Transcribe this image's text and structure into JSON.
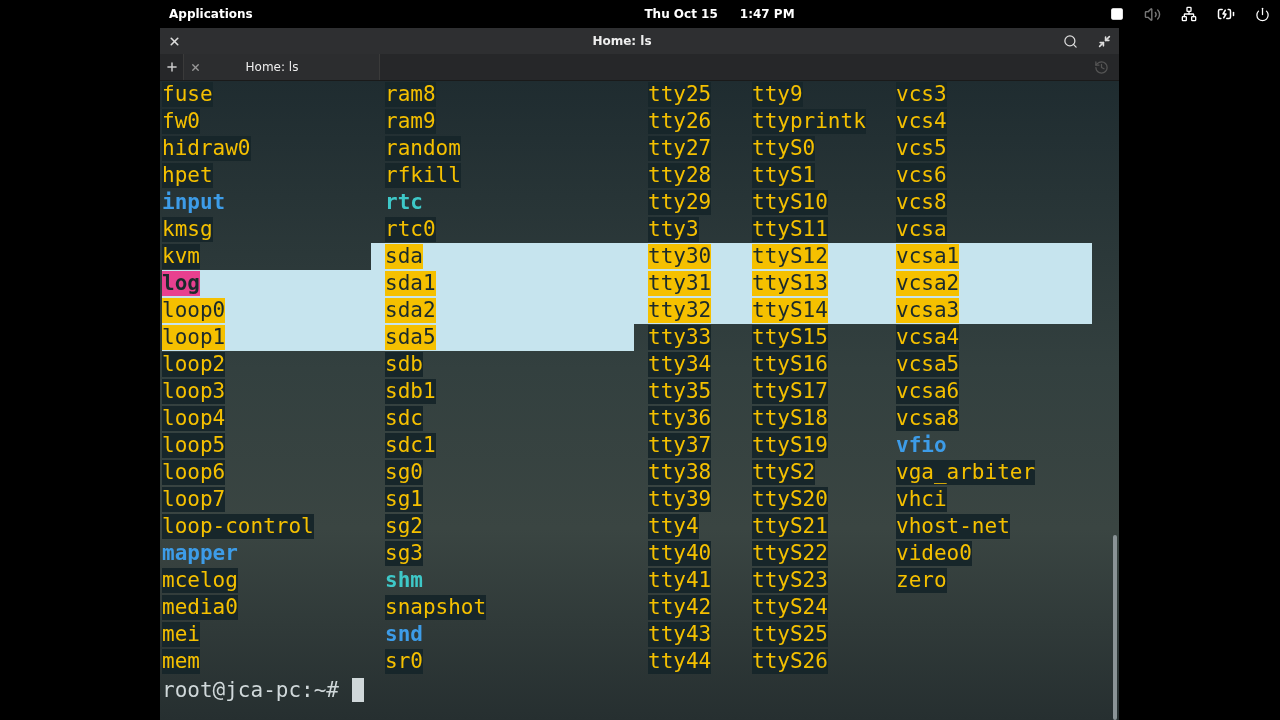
{
  "top_panel": {
    "menu": "Applications",
    "date": "Thu Oct 15",
    "time": "1:47 PM"
  },
  "window": {
    "title": "Home: ls"
  },
  "tabs": [
    {
      "label": "Home: ls",
      "selected": true
    }
  ],
  "terminal": {
    "rows": [
      {
        "cells": [
          {
            "text": "fuse",
            "kind": "device",
            "selected": false
          },
          {
            "text": "ram8",
            "kind": "device",
            "selected": false
          },
          {
            "text": "tty25",
            "kind": "device",
            "selected": false
          },
          {
            "text": "tty9",
            "kind": "device",
            "selected": false
          },
          {
            "text": "vcs3",
            "kind": "device",
            "selected": false
          }
        ]
      },
      {
        "cells": [
          {
            "text": "fw0",
            "kind": "device",
            "selected": false
          },
          {
            "text": "ram9",
            "kind": "device",
            "selected": false
          },
          {
            "text": "tty26",
            "kind": "device",
            "selected": false
          },
          {
            "text": "ttyprintk",
            "kind": "device",
            "selected": false
          },
          {
            "text": "vcs4",
            "kind": "device",
            "selected": false
          }
        ]
      },
      {
        "cells": [
          {
            "text": "hidraw0",
            "kind": "device",
            "selected": false
          },
          {
            "text": "random",
            "kind": "device",
            "selected": false
          },
          {
            "text": "tty27",
            "kind": "device",
            "selected": false
          },
          {
            "text": "ttyS0",
            "kind": "device",
            "selected": false
          },
          {
            "text": "vcs5",
            "kind": "device",
            "selected": false
          }
        ]
      },
      {
        "cells": [
          {
            "text": "hpet",
            "kind": "device",
            "selected": false
          },
          {
            "text": "rfkill",
            "kind": "device",
            "selected": false
          },
          {
            "text": "tty28",
            "kind": "device",
            "selected": false
          },
          {
            "text": "ttyS1",
            "kind": "device",
            "selected": false
          },
          {
            "text": "vcs6",
            "kind": "device",
            "selected": false
          }
        ]
      },
      {
        "cells": [
          {
            "text": "input",
            "kind": "dir",
            "selected": false
          },
          {
            "text": "rtc",
            "kind": "link",
            "selected": false
          },
          {
            "text": "tty29",
            "kind": "device",
            "selected": false
          },
          {
            "text": "ttyS10",
            "kind": "device",
            "selected": false
          },
          {
            "text": "vcs8",
            "kind": "device",
            "selected": false
          }
        ]
      },
      {
        "cells": [
          {
            "text": "kmsg",
            "kind": "device",
            "selected": false
          },
          {
            "text": "rtc0",
            "kind": "device",
            "selected": false
          },
          {
            "text": "tty3",
            "kind": "device",
            "selected": false
          },
          {
            "text": "ttyS11",
            "kind": "device",
            "selected": false
          },
          {
            "text": "vcsa",
            "kind": "device",
            "selected": false
          }
        ]
      },
      {
        "cells": [
          {
            "text": "kvm",
            "kind": "device",
            "selected": false
          },
          {
            "text": "sda",
            "kind": "device",
            "selected": true
          },
          {
            "text": "tty30",
            "kind": "device",
            "selected": true
          },
          {
            "text": "ttyS12",
            "kind": "device",
            "selected": true
          },
          {
            "text": "vcsa1",
            "kind": "device",
            "selected": true
          }
        ]
      },
      {
        "cells": [
          {
            "text": "log",
            "kind": "socket",
            "selected": true
          },
          {
            "text": "sda1",
            "kind": "device",
            "selected": true
          },
          {
            "text": "tty31",
            "kind": "device",
            "selected": true
          },
          {
            "text": "ttyS13",
            "kind": "device",
            "selected": true
          },
          {
            "text": "vcsa2",
            "kind": "device",
            "selected": true
          }
        ]
      },
      {
        "cells": [
          {
            "text": "loop0",
            "kind": "device",
            "selected": true
          },
          {
            "text": "sda2",
            "kind": "device",
            "selected": true
          },
          {
            "text": "tty32",
            "kind": "device",
            "selected": true
          },
          {
            "text": "ttyS14",
            "kind": "device",
            "selected": true
          },
          {
            "text": "vcsa3",
            "kind": "device",
            "selected": true
          }
        ]
      },
      {
        "cells": [
          {
            "text": "loop1",
            "kind": "device",
            "selected": true
          },
          {
            "text": "sda5",
            "kind": "device",
            "selected": true
          },
          {
            "text": "tty33",
            "kind": "device",
            "selected": false
          },
          {
            "text": "ttyS15",
            "kind": "device",
            "selected": false
          },
          {
            "text": "vcsa4",
            "kind": "device",
            "selected": false
          }
        ]
      },
      {
        "cells": [
          {
            "text": "loop2",
            "kind": "device",
            "selected": false
          },
          {
            "text": "sdb",
            "kind": "device",
            "selected": false
          },
          {
            "text": "tty34",
            "kind": "device",
            "selected": false
          },
          {
            "text": "ttyS16",
            "kind": "device",
            "selected": false
          },
          {
            "text": "vcsa5",
            "kind": "device",
            "selected": false
          }
        ]
      },
      {
        "cells": [
          {
            "text": "loop3",
            "kind": "device",
            "selected": false
          },
          {
            "text": "sdb1",
            "kind": "device",
            "selected": false
          },
          {
            "text": "tty35",
            "kind": "device",
            "selected": false
          },
          {
            "text": "ttyS17",
            "kind": "device",
            "selected": false
          },
          {
            "text": "vcsa6",
            "kind": "device",
            "selected": false
          }
        ]
      },
      {
        "cells": [
          {
            "text": "loop4",
            "kind": "device",
            "selected": false
          },
          {
            "text": "sdc",
            "kind": "device",
            "selected": false
          },
          {
            "text": "tty36",
            "kind": "device",
            "selected": false
          },
          {
            "text": "ttyS18",
            "kind": "device",
            "selected": false
          },
          {
            "text": "vcsa8",
            "kind": "device",
            "selected": false
          }
        ]
      },
      {
        "cells": [
          {
            "text": "loop5",
            "kind": "device",
            "selected": false
          },
          {
            "text": "sdc1",
            "kind": "device",
            "selected": false
          },
          {
            "text": "tty37",
            "kind": "device",
            "selected": false
          },
          {
            "text": "ttyS19",
            "kind": "device",
            "selected": false
          },
          {
            "text": "vfio",
            "kind": "dir",
            "selected": false
          }
        ]
      },
      {
        "cells": [
          {
            "text": "loop6",
            "kind": "device",
            "selected": false
          },
          {
            "text": "sg0",
            "kind": "device",
            "selected": false
          },
          {
            "text": "tty38",
            "kind": "device",
            "selected": false
          },
          {
            "text": "ttyS2",
            "kind": "device",
            "selected": false
          },
          {
            "text": "vga_arbiter",
            "kind": "device",
            "selected": false
          }
        ]
      },
      {
        "cells": [
          {
            "text": "loop7",
            "kind": "device",
            "selected": false
          },
          {
            "text": "sg1",
            "kind": "device",
            "selected": false
          },
          {
            "text": "tty39",
            "kind": "device",
            "selected": false
          },
          {
            "text": "ttyS20",
            "kind": "device",
            "selected": false
          },
          {
            "text": "vhci",
            "kind": "device",
            "selected": false
          }
        ]
      },
      {
        "cells": [
          {
            "text": "loop-control",
            "kind": "device",
            "selected": false
          },
          {
            "text": "sg2",
            "kind": "device",
            "selected": false
          },
          {
            "text": "tty4",
            "kind": "device",
            "selected": false
          },
          {
            "text": "ttyS21",
            "kind": "device",
            "selected": false
          },
          {
            "text": "vhost-net",
            "kind": "device",
            "selected": false
          }
        ]
      },
      {
        "cells": [
          {
            "text": "mapper",
            "kind": "dir",
            "selected": false
          },
          {
            "text": "sg3",
            "kind": "device",
            "selected": false
          },
          {
            "text": "tty40",
            "kind": "device",
            "selected": false
          },
          {
            "text": "ttyS22",
            "kind": "device",
            "selected": false
          },
          {
            "text": "video0",
            "kind": "device",
            "selected": false
          }
        ]
      },
      {
        "cells": [
          {
            "text": "mcelog",
            "kind": "device",
            "selected": false
          },
          {
            "text": "shm",
            "kind": "link",
            "selected": false
          },
          {
            "text": "tty41",
            "kind": "device",
            "selected": false
          },
          {
            "text": "ttyS23",
            "kind": "device",
            "selected": false
          },
          {
            "text": "zero",
            "kind": "device",
            "selected": false
          }
        ]
      },
      {
        "cells": [
          {
            "text": "media0",
            "kind": "device",
            "selected": false
          },
          {
            "text": "snapshot",
            "kind": "device",
            "selected": false
          },
          {
            "text": "tty42",
            "kind": "device",
            "selected": false
          },
          {
            "text": "ttyS24",
            "kind": "device",
            "selected": false
          }
        ]
      },
      {
        "cells": [
          {
            "text": "mei",
            "kind": "device",
            "selected": false
          },
          {
            "text": "snd",
            "kind": "dir",
            "selected": false
          },
          {
            "text": "tty43",
            "kind": "device",
            "selected": false
          },
          {
            "text": "ttyS25",
            "kind": "device",
            "selected": false
          }
        ]
      },
      {
        "cells": [
          {
            "text": "mem",
            "kind": "device",
            "selected": false
          },
          {
            "text": "sr0",
            "kind": "device",
            "selected": false
          },
          {
            "text": "tty44",
            "kind": "device",
            "selected": false
          },
          {
            "text": "ttyS26",
            "kind": "device",
            "selected": false
          }
        ]
      }
    ],
    "prompt": "root@jca-pc:~#"
  }
}
